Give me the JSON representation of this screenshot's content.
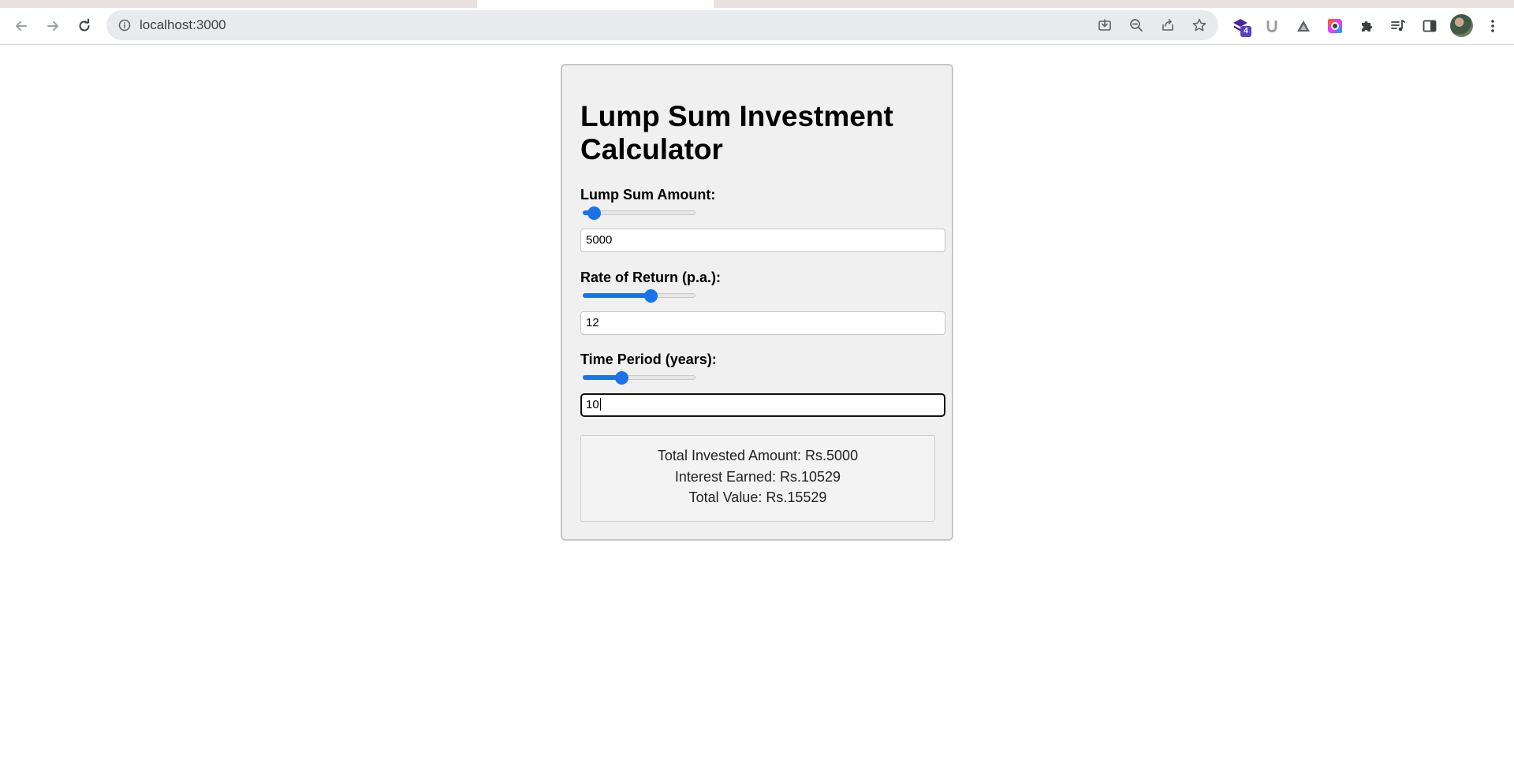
{
  "browser": {
    "url": "localhost:3000",
    "extension_badge_count": "4",
    "icons": {
      "back": "arrow-left-icon",
      "forward": "arrow-right-icon",
      "reload": "reload-icon",
      "site_info": "info-icon",
      "install": "install-icon",
      "zoom": "zoom-out-icon",
      "share": "share-icon",
      "bookmark": "star-icon",
      "extensions": "puzzle-icon",
      "media": "media-control-icon",
      "side_panel": "side-panel-icon",
      "menu": "kebab-menu-icon"
    }
  },
  "calculator": {
    "title": "Lump Sum Investment Calculator",
    "fields": [
      {
        "label": "Lump Sum Amount:",
        "value": "5000",
        "slider_fraction": 0.1
      },
      {
        "label": "Rate of Return (p.a.):",
        "value": "12",
        "slider_fraction": 0.6
      },
      {
        "label": "Time Period (years):",
        "value": "10",
        "slider_fraction": 0.34
      }
    ],
    "results": {
      "invested": "Total Invested Amount: Rs.5000",
      "interest": "Interest Earned: Rs.10529",
      "total": "Total Value: Rs.15529"
    }
  },
  "colors": {
    "accent": "#1a73e8",
    "card_background": "#f0f0f0"
  }
}
